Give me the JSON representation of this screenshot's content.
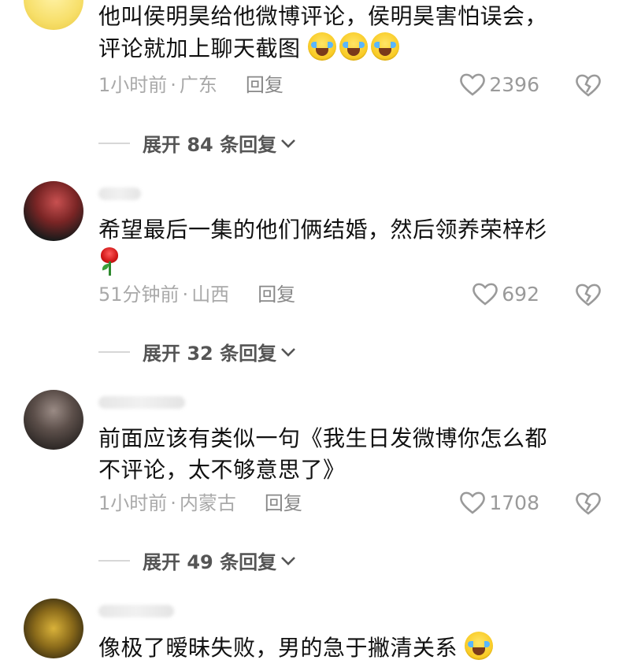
{
  "comments": [
    {
      "text_line1": "他叫侯明昊给他微博评论，侯明昊害怕误会，",
      "text_line2": "评论就加上聊天截图",
      "emoji": "crying-laughing-emoji",
      "time": "1小时前",
      "location": "广东",
      "reply_label": "回复",
      "likes": "2396",
      "expand_label": "展开 84 条回复"
    },
    {
      "text_line1": "希望最后一集的他们俩结婚，然后领养荣梓杉",
      "emoji": "rose-emoji",
      "time": "51分钟前",
      "location": "山西",
      "reply_label": "回复",
      "likes": "692",
      "expand_label": "展开 32 条回复"
    },
    {
      "text_line1": "前面应该有类似一句《我生日发微博你怎么都",
      "text_line2": "不评论，太不够意思了》",
      "time": "1小时前",
      "location": "内蒙古",
      "reply_label": "回复",
      "likes": "1708",
      "expand_label": "展开 49 条回复"
    },
    {
      "text_line1": "像极了暧昧失败，男的急于撇清关系",
      "emoji": "laughing-tears-emoji"
    }
  ],
  "separator": "·",
  "colors": {
    "text": "#111111",
    "meta": "#a9a9a9",
    "expand": "#555555",
    "divider": "#d7d7d7"
  }
}
